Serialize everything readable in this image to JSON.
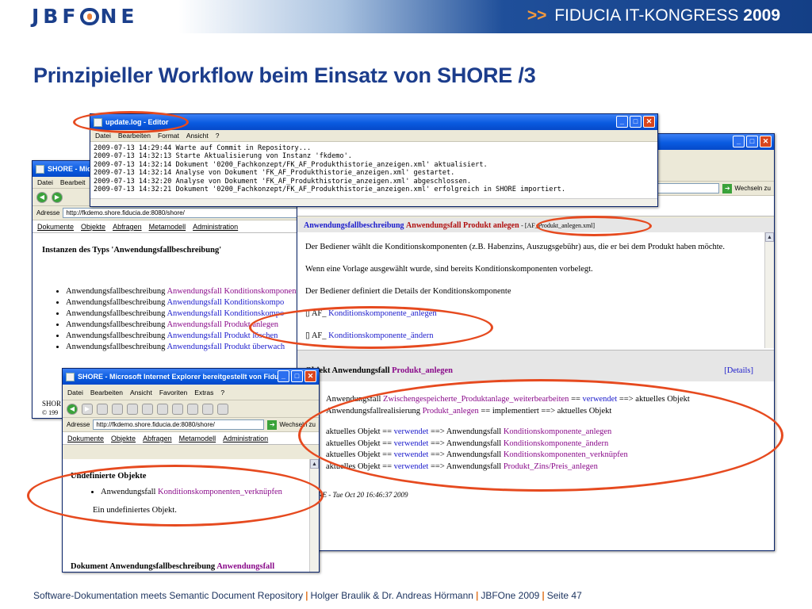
{
  "header": {
    "logo": "JBF",
    "logo_rest": "NE",
    "congress_arrows": ">>",
    "congress_text": "FIDUCIA IT-KONGRESS",
    "congress_year": "2009"
  },
  "title": "Prinzipieller Workflow beim Einsatz von SHORE  /3",
  "editor": {
    "title": "update.log - Editor",
    "menu": [
      "Datei",
      "Bearbeiten",
      "Format",
      "Ansicht",
      "?"
    ],
    "lines": [
      "2009-07-13 14:29:44 Warte auf Commit in Repository...",
      "2009-07-13 14:32:13 Starte Aktualisierung von Instanz 'fkdemo'.",
      "2009-07-13 14:32:14 Dokument '0200_Fachkonzept/FK_AF_Produkthistorie_anzeigen.xml' aktualisiert.",
      "2009-07-13 14:32:14 Analyse von Dokument 'FK_AF_Produkthistorie_anzeigen.xml' gestartet.",
      "2009-07-13 14:32:20 Analyse von Dokument 'FK_AF_Produkthistorie_anzeigen.xml' abgeschlossen.",
      "2009-07-13 14:32:21 Dokument '0200_Fachkonzept/FK_AF_Produkthistorie_anzeigen.xml' erfolgreich in SHORE importiert."
    ]
  },
  "back_window": {
    "title": "SHORE - Micro",
    "menu": [
      "Datei",
      "Bearbeit"
    ],
    "address_label": "Adresse",
    "address": "http://fkdemo.shore.fiducia.de:8080/shore/",
    "nav": [
      "Dokumente",
      "Objekte",
      "Abfragen",
      "Metamodell",
      "Administration"
    ],
    "heading": "Instanzen des Typs 'Anwendungsfallbeschreibung'",
    "items": [
      {
        "prefix": "Anwendungsfallbeschreibung",
        "link": "Anwendungsfall Konditionskomponenten"
      },
      {
        "prefix": "Anwendungsfallbeschreibung",
        "link": "Anwendungsfall Konditionskompo"
      },
      {
        "prefix": "Anwendungsfallbeschreibung",
        "link": "Anwendungsfall Konditionskompo"
      },
      {
        "prefix": "Anwendungsfallbeschreibung",
        "link": "Anwendungsfall Produkt anlegen"
      },
      {
        "prefix": "Anwendungsfallbeschreibung",
        "link": "Anwendungsfall Produkt löschen"
      },
      {
        "prefix": "Anwendungsfallbeschreibung",
        "link": "Anwendungsfall Produkt überwach"
      }
    ],
    "status": "SHOR",
    "status2": "© 199"
  },
  "main_window": {
    "address_right": "Wechseln zu",
    "section_title_a": "Anwendungsfallbeschreibung",
    "section_title_b": "Anwendungsfall Produkt anlegen",
    "section_file": "- [AF_Produkt_anlegen.xml]",
    "p1": "Der Bediener wählt die Konditionskomponenten (z.B. Habenzins, Auszugsgebühr) aus, die er bei dem Produkt haben möchte.",
    "p2": "Wenn eine Vorlage ausgewählt wurde, sind bereits Konditionskomponenten vorbelegt.",
    "p3": "Der Bediener definiert die Details der Konditionskomponente",
    "links": [
      {
        "bullet": "AF_",
        "text": "Konditionskomponente_anlegen"
      },
      {
        "bullet": "AF_",
        "text": "Konditionskomponente_ändern"
      }
    ],
    "object_title_a": "Objekt Anwendungsfall",
    "object_title_b": "Produkt_anlegen",
    "details": "[Details]",
    "relations": [
      {
        "a": "Anwendungsfall",
        "b": "Zwischengespeicherte_Produktanlage_weiterbearbeiten",
        "c": " == ",
        "d": "verwendet",
        "e": " ==> aktuelles Objekt"
      },
      {
        "a": "Anwendungsfallrealisierung",
        "b": "Produkt_anlegen",
        "c": " == implementiert ==> aktuelles Objekt",
        "d": "",
        "e": ""
      }
    ],
    "relations2": [
      {
        "a": "aktuelles Objekt == ",
        "b": "verwendet",
        "c": " ==> Anwendungsfall ",
        "d": "Konditionskomponente_anlegen"
      },
      {
        "a": "aktuelles Objekt == ",
        "b": "verwendet",
        "c": " ==> Anwendungsfall ",
        "d": "Konditionskomponente_ändern"
      },
      {
        "a": "aktuelles Objekt == ",
        "b": "verwendet",
        "c": " ==> Anwendungsfall ",
        "d": "Konditionskomponenten_verknüpfen"
      },
      {
        "a": "aktuelles Objekt == ",
        "b": "verwendet",
        "c": " ==> Anwendungsfall ",
        "d": "Produkt_Zins/Preis_anlegen"
      }
    ],
    "timestamp": "RE - Tue Oct 20 16:46:37 2009"
  },
  "ie_window": {
    "title": "SHORE - Microsoft Internet Explorer bereitgestellt von Fiduc...",
    "menu": [
      "Datei",
      "Bearbeiten",
      "Ansicht",
      "Favoriten",
      "Extras",
      "?"
    ],
    "address_label": "Adresse",
    "address": "http://fkdemo.shore.fiducia.de:8080/shore/",
    "go": "Wechseln zu",
    "nav": [
      "Dokumente",
      "Objekte",
      "Abfragen",
      "Metamodell",
      "Administration"
    ],
    "heading": "Undefinierte Objekte",
    "item_prefix": "Anwendungsfall",
    "item_link": "Konditionskomponenten_verknüpfen",
    "note": "Ein undefiniertes Objekt.",
    "bottom_a": "Dokument Anwendungsfallbeschreibung",
    "bottom_b": "Anwendungsfall"
  },
  "footer": {
    "part1": "Software-Dokumentation meets Semantic Document Repository",
    "sep": "|",
    "part2": "Holger Braulik & Dr. Andreas Hörmann",
    "part3": "JBFOne 2009",
    "part4": "Seite 47"
  },
  "colors": {
    "accent_orange": "#e64a1f",
    "title_blue": "#1c3d8c",
    "link_blue": "#1a1acb",
    "link_purple": "#8a0a8a"
  }
}
